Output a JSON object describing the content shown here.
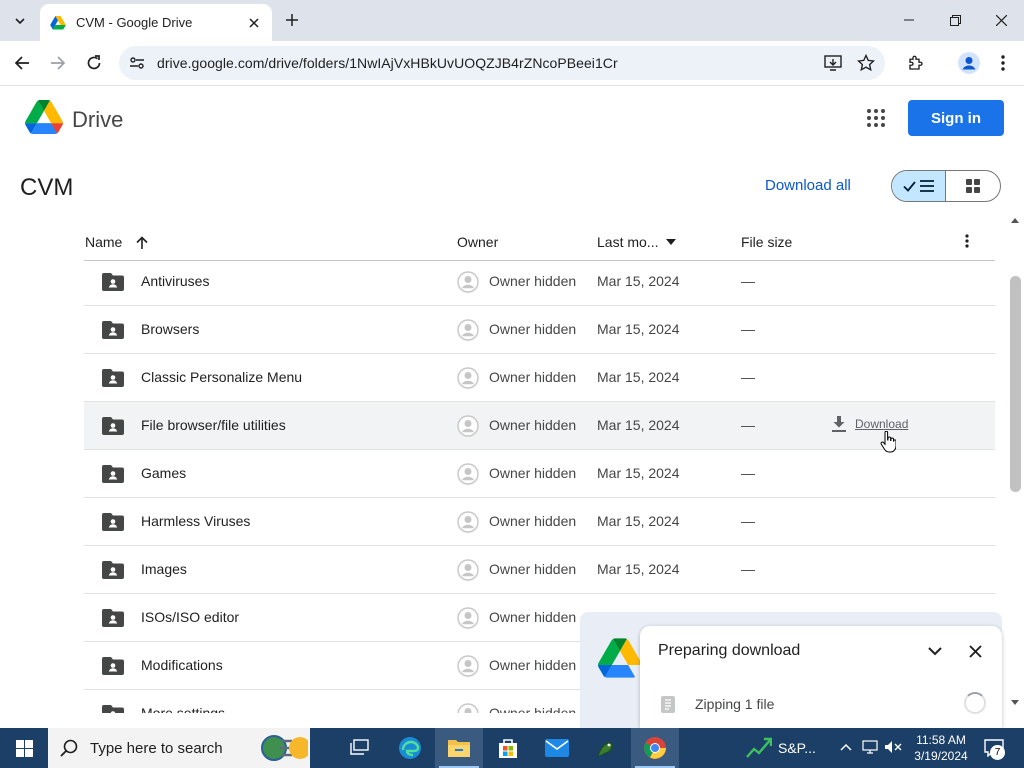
{
  "browser": {
    "tab_title": "CVM - Google Drive",
    "url": "drive.google.com/drive/folders/1NwIAjVxHBkUvUOQZJB4rZNcoPBeei1Cr"
  },
  "drive": {
    "brand": "Drive",
    "sign_in": "Sign in",
    "folder_title": "CVM",
    "download_all": "Download all"
  },
  "table": {
    "columns": {
      "name": "Name",
      "owner": "Owner",
      "modified": "Last mo...",
      "size": "File size"
    },
    "rows": [
      {
        "name": "Antiviruses",
        "owner": "Owner hidden",
        "modified": "Mar 15, 2024",
        "size": "—"
      },
      {
        "name": "Browsers",
        "owner": "Owner hidden",
        "modified": "Mar 15, 2024",
        "size": "—"
      },
      {
        "name": "Classic Personalize Menu",
        "owner": "Owner hidden",
        "modified": "Mar 15, 2024",
        "size": "—"
      },
      {
        "name": "File browser/file utilities",
        "owner": "Owner hidden",
        "modified": "Mar 15, 2024",
        "size": "—",
        "action": "Download"
      },
      {
        "name": "Games",
        "owner": "Owner hidden",
        "modified": "Mar 15, 2024",
        "size": "—"
      },
      {
        "name": "Harmless Viruses",
        "owner": "Owner hidden",
        "modified": "Mar 15, 2024",
        "size": "—"
      },
      {
        "name": "Images",
        "owner": "Owner hidden",
        "modified": "Mar 15, 2024",
        "size": "—"
      },
      {
        "name": "ISOs/ISO editor",
        "owner": "Owner hidden",
        "modified": "",
        "size": ""
      },
      {
        "name": "Modifications",
        "owner": "Owner hidden",
        "modified": "",
        "size": ""
      },
      {
        "name": "More settings",
        "owner": "Owner hidden",
        "modified": "",
        "size": ""
      }
    ]
  },
  "toast": {
    "title": "Preparing download",
    "item": "Zipping 1 file"
  },
  "taskbar": {
    "search_placeholder": "Type here to search",
    "stock_label": "S&P...",
    "time": "11:58 AM",
    "date": "3/19/2024",
    "notification_count": "7"
  },
  "colors": {
    "accent": "#1a73e8",
    "link": "#0b57d0",
    "toggle_selected": "#c2e7ff",
    "taskbar": "#1b3f66"
  }
}
